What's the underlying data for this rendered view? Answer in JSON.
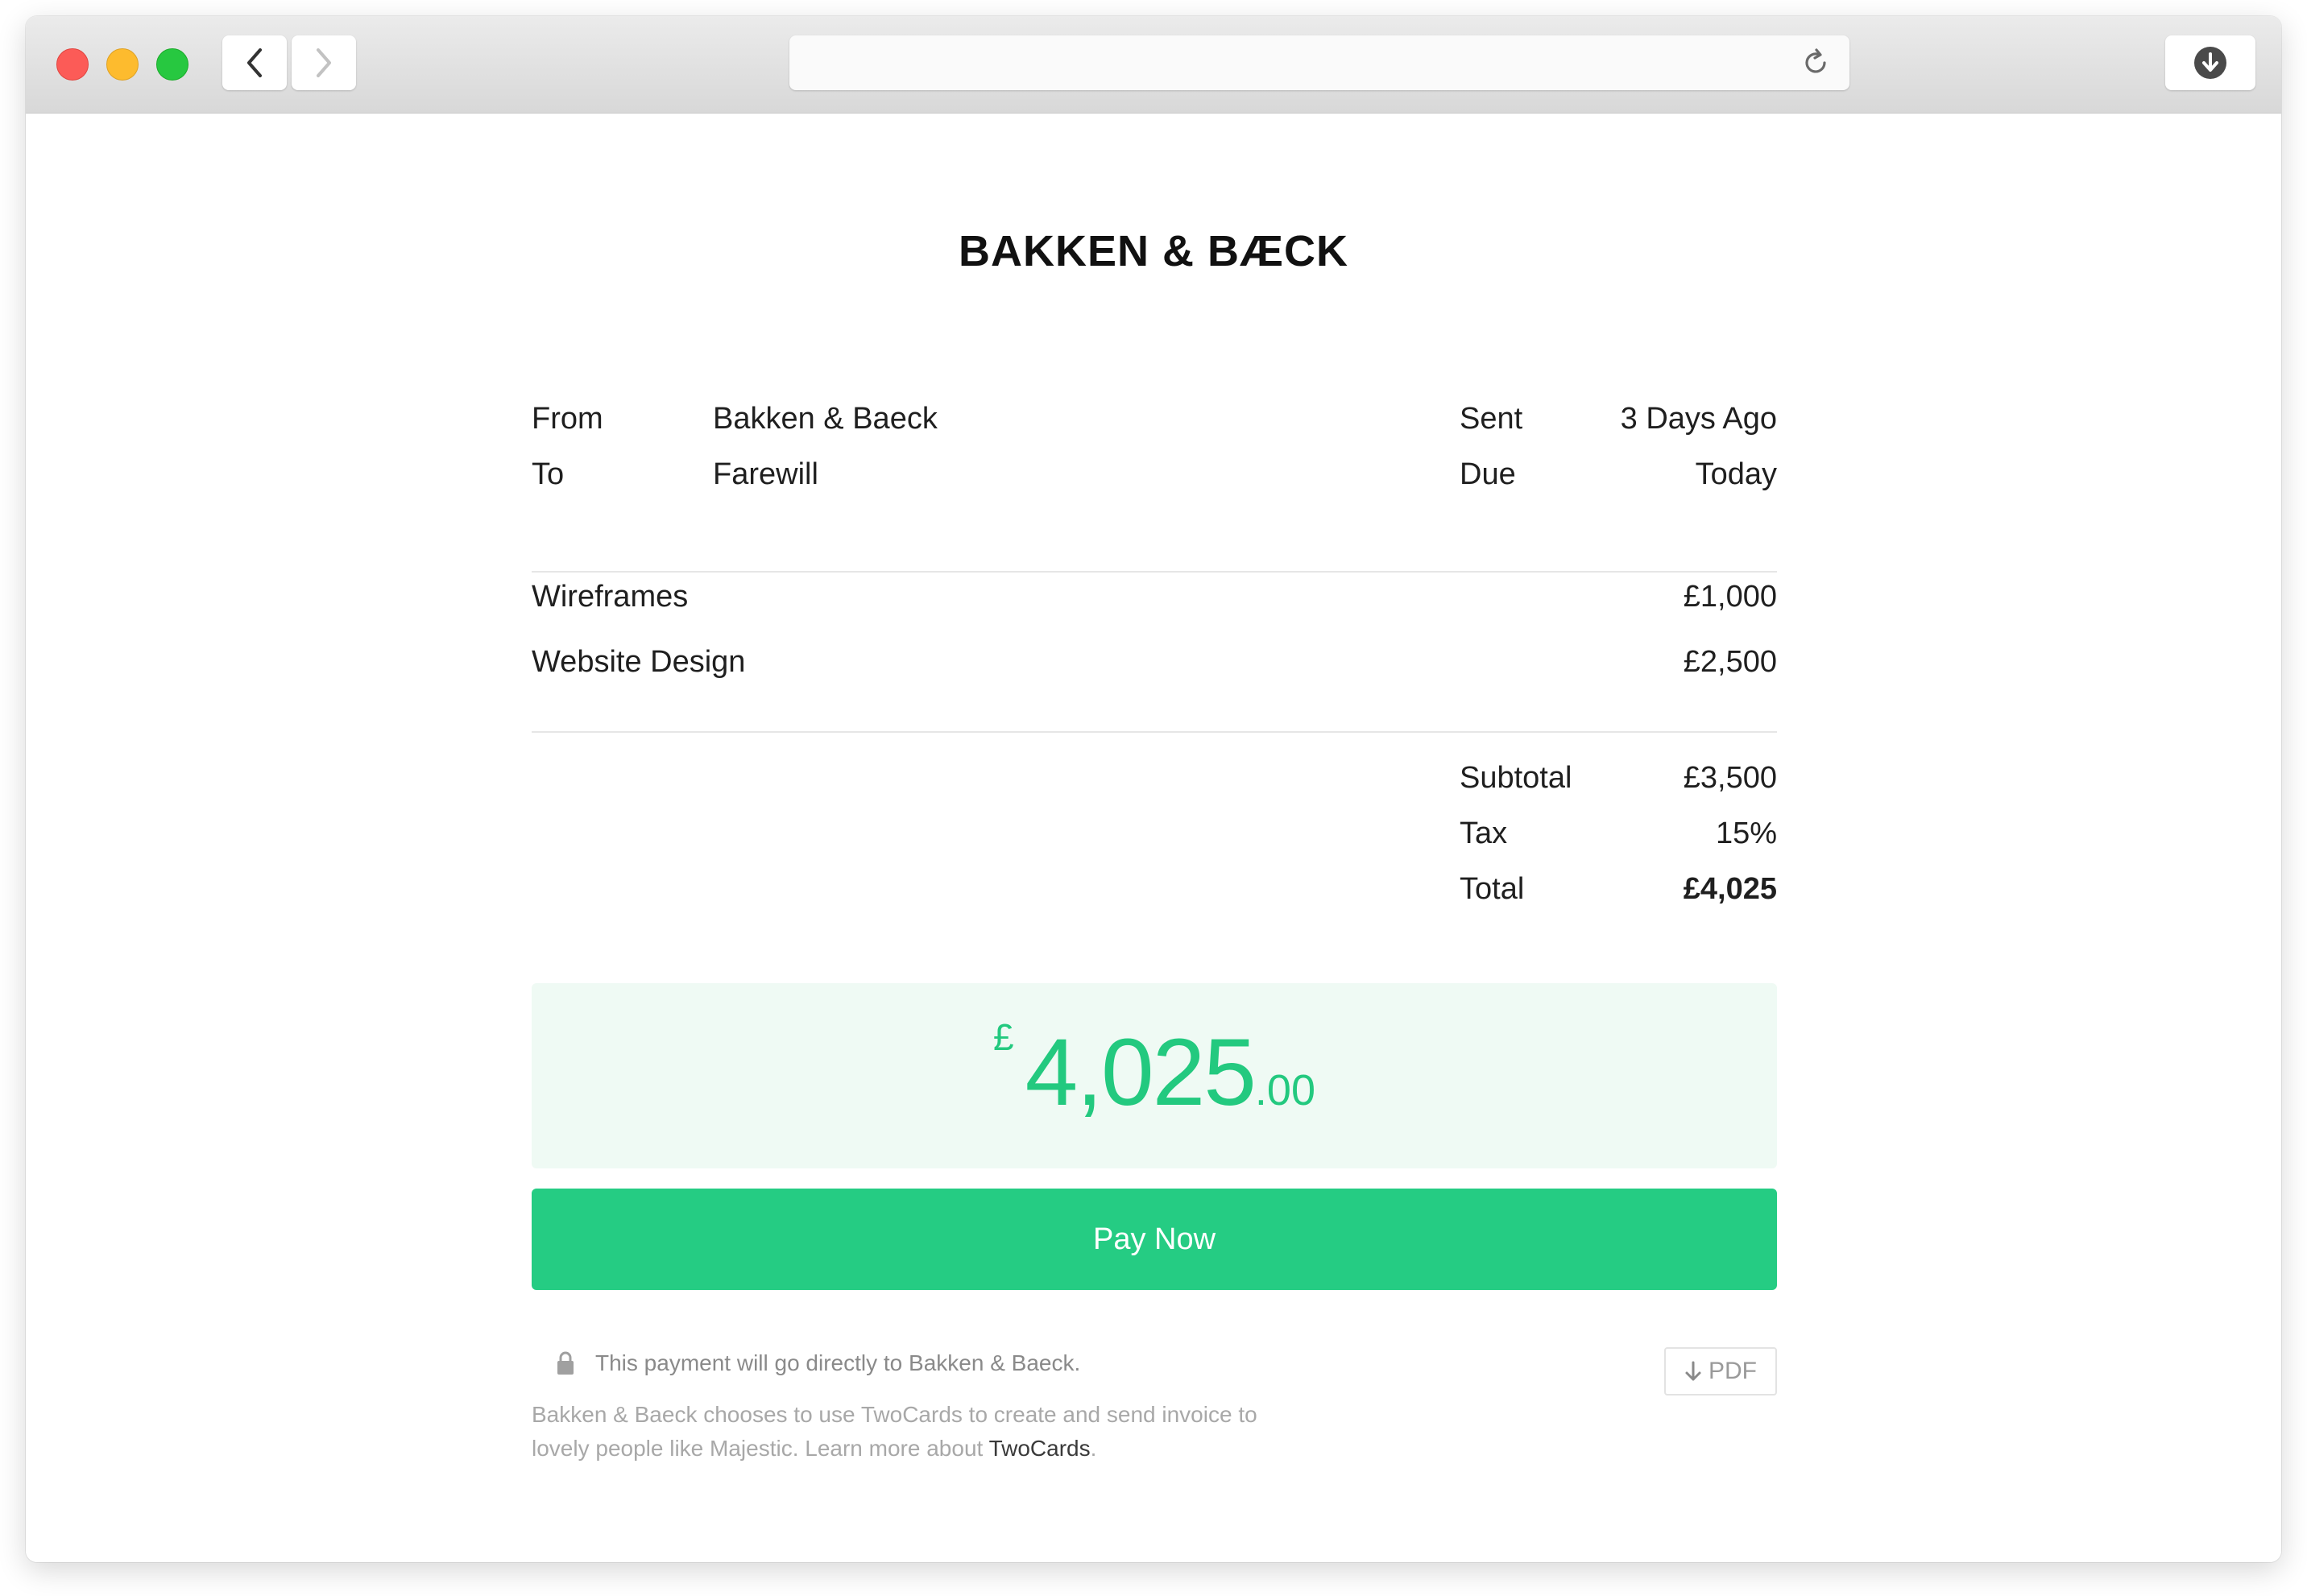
{
  "browser": {
    "address_value": "",
    "icons": [
      "back-icon",
      "forward-icon",
      "reload-icon",
      "download-icon"
    ]
  },
  "invoice": {
    "brand": "BAKKEN & BÆCK",
    "meta": {
      "from_label": "From",
      "from_value": "Bakken & Baeck",
      "to_label": "To",
      "to_value": "Farewill",
      "sent_label": "Sent",
      "sent_value": "3 Days Ago",
      "due_label": "Due",
      "due_value": "Today"
    },
    "items": [
      {
        "name": "Wireframes",
        "amount": "£1,000"
      },
      {
        "name": "Website Design",
        "amount": "£2,500"
      }
    ],
    "totals": {
      "subtotal_label": "Subtotal",
      "subtotal_value": "£3,500",
      "tax_label": "Tax",
      "tax_value": "15%",
      "total_label": "Total",
      "total_value": "£4,025"
    },
    "amount_due": {
      "currency": "£",
      "whole": "4,025",
      "cents": ".00"
    },
    "pay_button": "Pay Now",
    "secure_note": "This payment will go directly to Bakken & Baeck.",
    "pdf_button": "PDF",
    "footer_text": "Bakken & Baeck chooses to use TwoCards to create and send invoice to lovely people like Majestic. Learn more about ",
    "footer_link": "TwoCards",
    "footer_end": "."
  },
  "colors": {
    "accent_green": "#25cc83",
    "amount_bg": "#effaf4",
    "amount_text": "#23c97f"
  }
}
